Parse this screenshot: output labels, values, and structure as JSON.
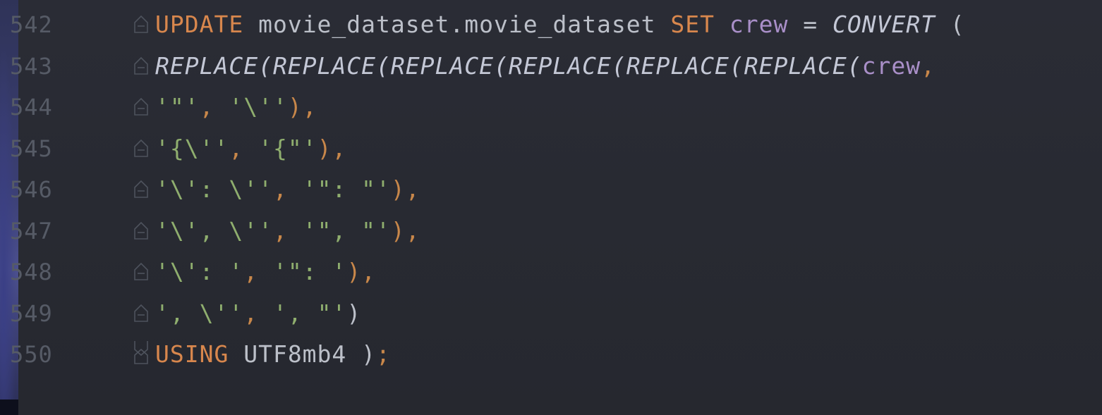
{
  "editor": {
    "lines": [
      {
        "number": "542",
        "tokens": [
          {
            "text": "UPDATE",
            "cls": "kw"
          },
          {
            "text": " movie_dataset.movie_dataset ",
            "cls": "plain"
          },
          {
            "text": "SET",
            "cls": "kw"
          },
          {
            "text": " ",
            "cls": "plain"
          },
          {
            "text": "crew",
            "cls": "id"
          },
          {
            "text": " = ",
            "cls": "plain"
          },
          {
            "text": "CONVERT",
            "cls": "fn"
          },
          {
            "text": " (",
            "cls": "plain"
          }
        ]
      },
      {
        "number": "543",
        "tokens": [
          {
            "text": "REPLACE(REPLACE(REPLACE(REPLACE(REPLACE(REPLACE(",
            "cls": "fn"
          },
          {
            "text": "crew",
            "cls": "id"
          },
          {
            "text": ",",
            "cls": "punct"
          }
        ]
      },
      {
        "number": "544",
        "tokens": [
          {
            "text": "'\"'",
            "cls": "str"
          },
          {
            "text": ", ",
            "cls": "punct"
          },
          {
            "text": "'\\''",
            "cls": "str"
          },
          {
            "text": "),",
            "cls": "punct"
          }
        ]
      },
      {
        "number": "545",
        "tokens": [
          {
            "text": "'{\\''",
            "cls": "str"
          },
          {
            "text": ", ",
            "cls": "punct"
          },
          {
            "text": "'{\"'",
            "cls": "str"
          },
          {
            "text": "),",
            "cls": "punct"
          }
        ]
      },
      {
        "number": "546",
        "tokens": [
          {
            "text": "'\\': \\''",
            "cls": "str"
          },
          {
            "text": ", ",
            "cls": "punct"
          },
          {
            "text": "'\": \"'",
            "cls": "str"
          },
          {
            "text": "),",
            "cls": "punct"
          }
        ]
      },
      {
        "number": "547",
        "tokens": [
          {
            "text": "'\\', \\''",
            "cls": "str"
          },
          {
            "text": ", ",
            "cls": "punct"
          },
          {
            "text": "'\", \"'",
            "cls": "str"
          },
          {
            "text": "),",
            "cls": "punct"
          }
        ]
      },
      {
        "number": "548",
        "tokens": [
          {
            "text": "'\\': '",
            "cls": "str"
          },
          {
            "text": ", ",
            "cls": "punct"
          },
          {
            "text": "'\": '",
            "cls": "str"
          },
          {
            "text": "),",
            "cls": "punct"
          }
        ]
      },
      {
        "number": "549",
        "tokens": [
          {
            "text": "', \\''",
            "cls": "str"
          },
          {
            "text": ", ",
            "cls": "punct"
          },
          {
            "text": "', \"'",
            "cls": "str"
          },
          {
            "text": ")",
            "cls": "plain"
          }
        ]
      },
      {
        "number": "550",
        "tokens": [
          {
            "text": "USING",
            "cls": "kw"
          },
          {
            "text": " UTF8mb4 )",
            "cls": "plain"
          },
          {
            "text": ";",
            "cls": "punct"
          }
        ]
      }
    ],
    "fold_markers": [
      "fold-start",
      "fold-start",
      "fold-start",
      "fold-start",
      "fold-start",
      "fold-start",
      "fold-start",
      "fold-start",
      "fold-end"
    ]
  },
  "colors": {
    "background": "#26282f",
    "keyword": "#d8874d",
    "function": "#c4c8d6",
    "identifier": "#a98fc8",
    "string": "#8fae6e",
    "punctuation": "#c8874a",
    "line_number": "#565b66"
  }
}
